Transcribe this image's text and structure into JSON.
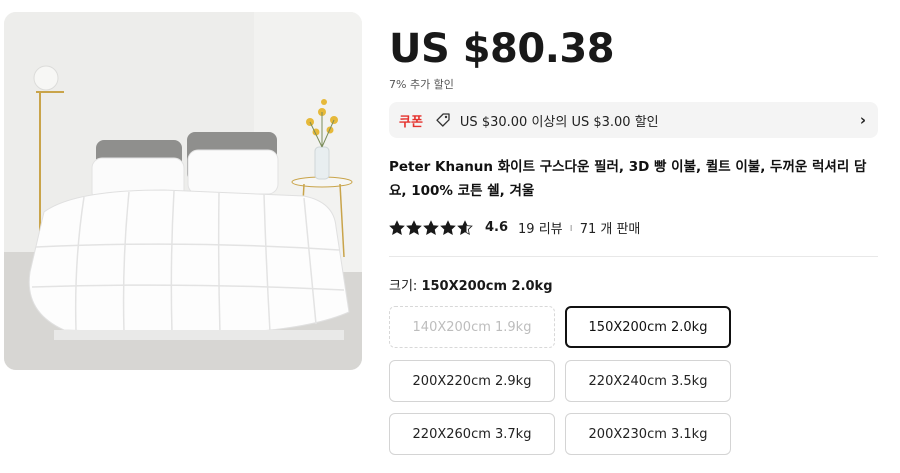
{
  "product": {
    "image_alt": "white goose down comforter on bed",
    "price": "US $80.38",
    "discount_note": "7% 추가 할인",
    "coupon": {
      "label": "쿠폰",
      "text": "US $30.00 이상의 US $3.00 할인",
      "icon": "tag-icon",
      "chevron": "›"
    },
    "title": "Peter Khanun 화이트 구스다운 필러, 3D 빵 이불, 퀼트 이불, 두꺼운 럭셔리 담요, 100% 코튼 쉘, 겨울",
    "rating": {
      "stars": 4.6,
      "value": "4.6",
      "reviews": "19 리뷰",
      "separator": "ı",
      "sold": "71 개 판매"
    },
    "size": {
      "label": "크기:",
      "selected_value": "150X200cm 2.0kg",
      "options": [
        {
          "label": "140X200cm 1.9kg",
          "state": "disabled"
        },
        {
          "label": "150X200cm 2.0kg",
          "state": "selected"
        },
        {
          "label": "200X220cm 2.9kg",
          "state": "available"
        },
        {
          "label": "220X240cm 3.5kg",
          "state": "available"
        },
        {
          "label": "220X260cm 3.7kg",
          "state": "available"
        },
        {
          "label": "200X230cm 3.1kg",
          "state": "available"
        }
      ]
    }
  },
  "colors": {
    "coupon_red": "#e5322d",
    "star": "#191919",
    "selected_border": "#111111"
  }
}
